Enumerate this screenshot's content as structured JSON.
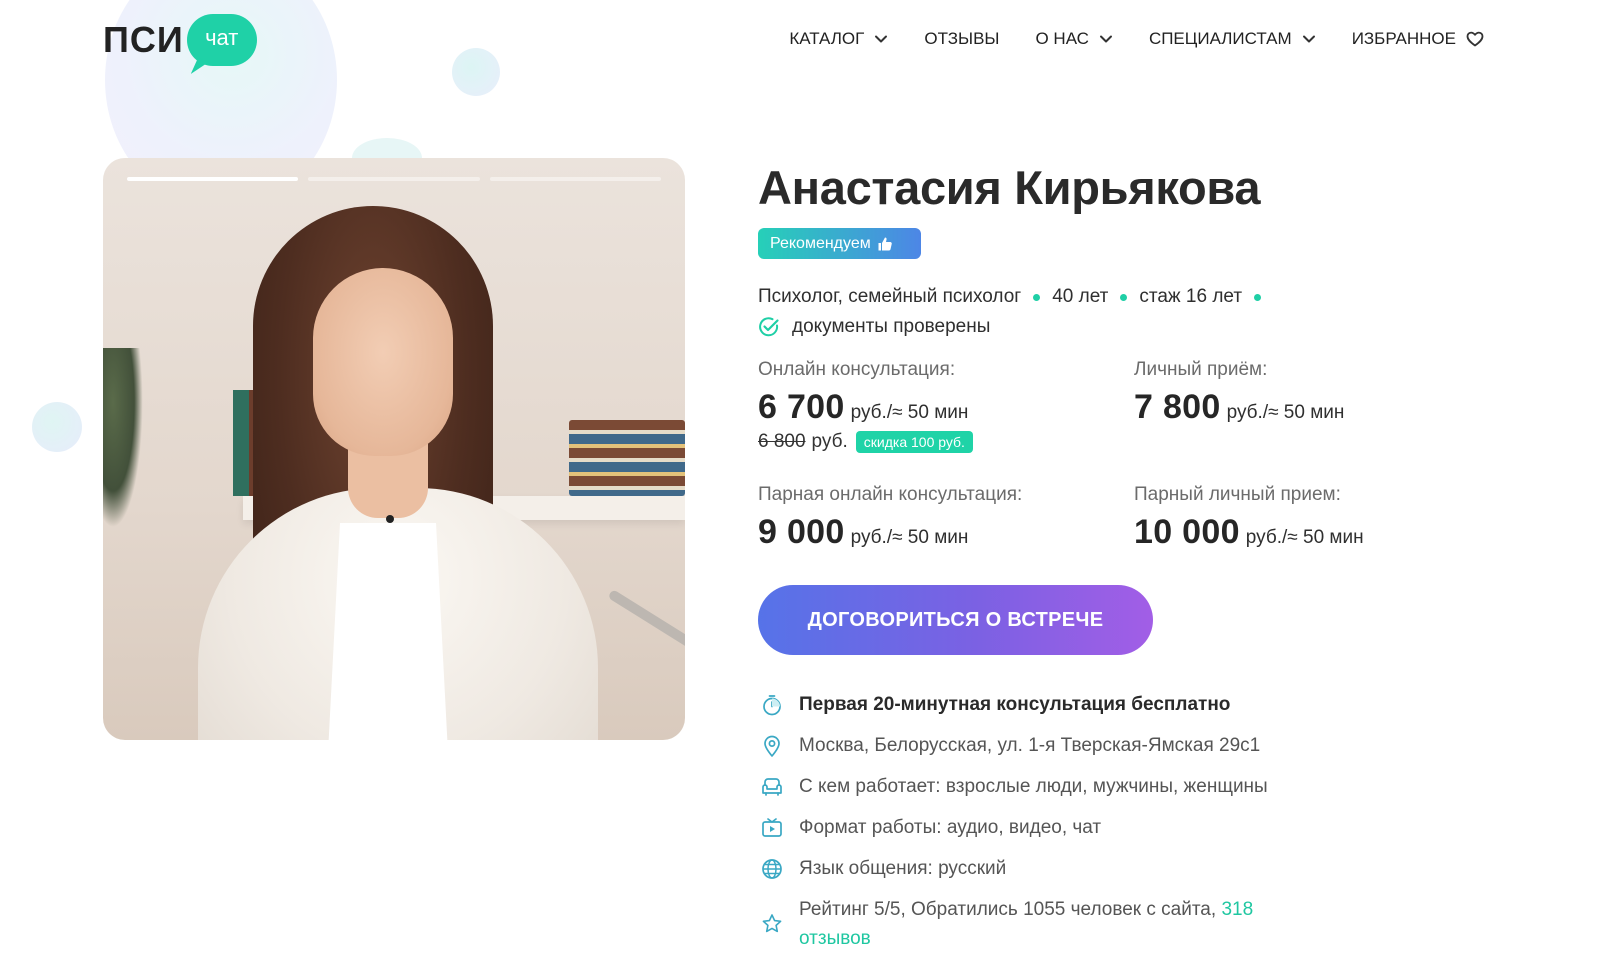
{
  "brand": {
    "logo_main": "ПСИ",
    "logo_bubble": "чат",
    "accent": "#1fd1a7"
  },
  "nav": {
    "items": [
      {
        "label": "КАТАЛОГ",
        "dropdown": true,
        "icon": "chevron-down-icon"
      },
      {
        "label": "ОТЗЫВЫ",
        "dropdown": false
      },
      {
        "label": "О НАС",
        "dropdown": true,
        "icon": "chevron-down-icon"
      },
      {
        "label": "СПЕЦИАЛИСТАМ",
        "dropdown": true,
        "icon": "chevron-down-icon"
      },
      {
        "label": "ИЗБРАННОЕ",
        "dropdown": false,
        "icon": "heart-icon"
      }
    ]
  },
  "gallery": {
    "slides": 3,
    "active_slide": 1
  },
  "profile": {
    "name": "Анастасия Кирьякова",
    "badge": "Рекомендуем",
    "specialization": "Психолог, семейный психолог",
    "age": "40 лет",
    "experience": "стаж 16 лет",
    "verified": "документы проверены"
  },
  "prices": {
    "online": {
      "label": "Онлайн консультация:",
      "value": "6 700",
      "unit": "руб./≈ 50 мин",
      "old_value": "6 800",
      "old_currency": "руб.",
      "discount": "скидка 100 руб."
    },
    "personal": {
      "label": "Личный приём:",
      "value": "7 800",
      "unit": "руб./≈ 50 мин"
    },
    "pair_online": {
      "label": "Парная онлайн консультация:",
      "value": "9 000",
      "unit": "руб./≈ 50 мин"
    },
    "pair_personal": {
      "label": "Парный личный прием:",
      "value": "10 000",
      "unit": "руб./≈ 50 мин"
    }
  },
  "cta": {
    "label": "ДОГОВОРИТЬСЯ О ВСТРЕЧЕ"
  },
  "features": {
    "free": "Первая 20-минутная консультация бесплатно",
    "address": "Москва, Белорусская, ул. 1-я Тверская-Ямская 29с1",
    "clients": "С кем работает: взрослые люди, мужчины, женщины",
    "format": "Формат работы: аудио, видео, чат",
    "language": "Язык общения: русский",
    "rating": "Рейтинг 5/5, Обратились 1055 человек с сайта,",
    "reviews_link": "318 отзывов"
  },
  "colors": {
    "accent_green": "#1fd1a7",
    "cta_gradient_start": "#5673e8",
    "cta_gradient_end": "#a25ee6",
    "icon_color": "#3aa8c4"
  }
}
